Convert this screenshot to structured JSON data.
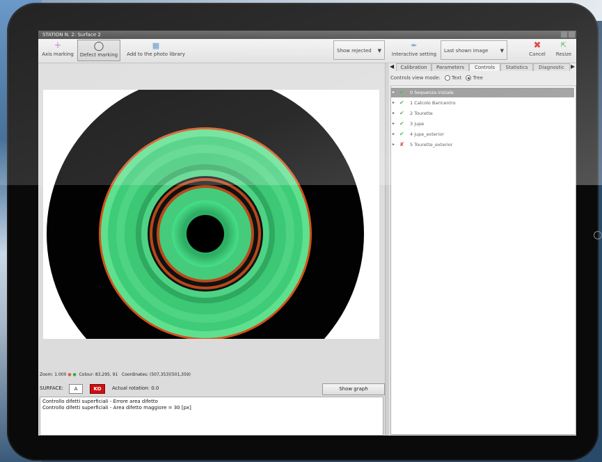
{
  "window": {
    "title": "STATION N. 2: Surface 2"
  },
  "toolbar": {
    "axis_marking": "Axis marking",
    "defect_marking": "Defect marking",
    "add_photo": "Add to the photo library",
    "show_rejected": "Show rejected",
    "interactive_setting": "Interactive setting",
    "last_shown_image": "Last shown image",
    "cancel": "Cancel",
    "resize": "Resize"
  },
  "status": {
    "zoom": "Zoom: 1.000",
    "colour": "Colour:   83,295, 91",
    "coordinates": "Coordinates:   (507,353)(501,359)"
  },
  "surface": {
    "label": "SURFACE:",
    "value": "A",
    "result": "KO",
    "rotation": "Actual rotation: 0.0",
    "show_graph": "Show graph"
  },
  "log": [
    "Controllo difetti superficiali - Errore area difetto",
    "Controllo difetti superficiali - Area difetto maggiore = 30 [px]"
  ],
  "tabs": [
    "Calibration",
    "Parameters",
    "Controls",
    "Statistics",
    "Diagnostic"
  ],
  "active_tab": "Controls",
  "view_mode": {
    "label": "Controls view mode:",
    "text_option": "Text",
    "tree_option": "Tree",
    "selected": "Tree"
  },
  "tree": [
    {
      "label": "0 Sequenza iniziale",
      "status": "ok",
      "selected": true
    },
    {
      "label": "1 Calcolo Baricentro",
      "status": "ok",
      "selected": false
    },
    {
      "label": "2 Tourette",
      "status": "ok",
      "selected": false
    },
    {
      "label": "3 jupe",
      "status": "ok",
      "selected": false
    },
    {
      "label": "4 jupe_exterior",
      "status": "ok",
      "selected": false
    },
    {
      "label": "5 Tourette_exterior",
      "status": "ko",
      "selected": false
    }
  ],
  "colors": {
    "ok": "#2fa82f",
    "ko": "#d42020",
    "disc_green": "#3fd67a",
    "rim_orange": "#d45a1e"
  }
}
